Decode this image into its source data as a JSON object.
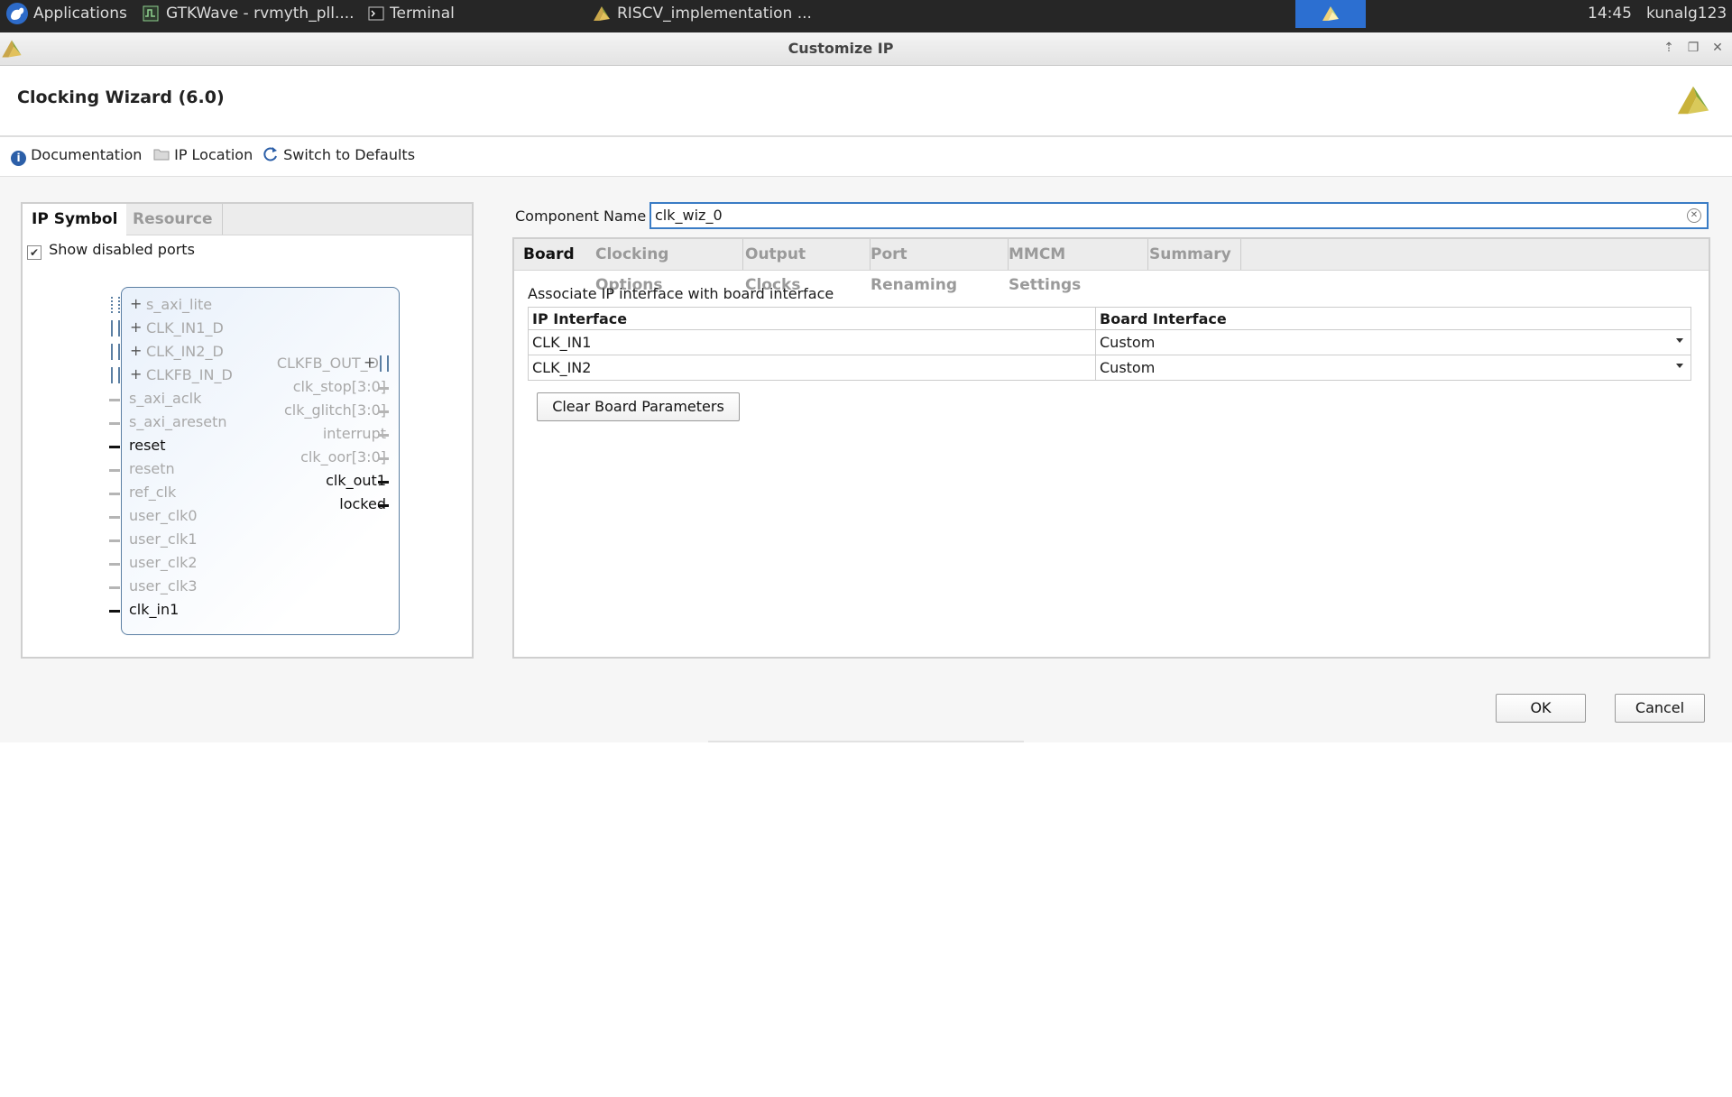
{
  "taskbar": {
    "applications_label": "Applications",
    "items": [
      "GTKWave - rvmyth_pll....",
      "Terminal",
      "RISCV_implementation ..."
    ],
    "clock": "14:45",
    "user": "kunalg123"
  },
  "window": {
    "title": "Customize IP"
  },
  "header": {
    "title": "Clocking Wizard (6.0)"
  },
  "toolbar": {
    "documentation": "Documentation",
    "ip_location": "IP Location",
    "switch_defaults": "Switch to Defaults"
  },
  "left_panel": {
    "tabs": [
      "IP Symbol",
      "Resource"
    ],
    "show_disabled_ports_label": "Show disabled ports",
    "show_disabled_ports_checked": true,
    "left_ports": [
      {
        "label": "s_axi_lite",
        "enabled": false,
        "bus": true
      },
      {
        "label": "CLK_IN1_D",
        "enabled": false,
        "bus": true
      },
      {
        "label": "CLK_IN2_D",
        "enabled": false,
        "bus": true
      },
      {
        "label": "CLKFB_IN_D",
        "enabled": false,
        "bus": true
      },
      {
        "label": "s_axi_aclk",
        "enabled": false,
        "bus": false
      },
      {
        "label": "s_axi_aresetn",
        "enabled": false,
        "bus": false
      },
      {
        "label": "reset",
        "enabled": true,
        "bus": false
      },
      {
        "label": "resetn",
        "enabled": false,
        "bus": false
      },
      {
        "label": "ref_clk",
        "enabled": false,
        "bus": false
      },
      {
        "label": "user_clk0",
        "enabled": false,
        "bus": false
      },
      {
        "label": "user_clk1",
        "enabled": false,
        "bus": false
      },
      {
        "label": "user_clk2",
        "enabled": false,
        "bus": false
      },
      {
        "label": "user_clk3",
        "enabled": false,
        "bus": false
      },
      {
        "label": "clk_in1",
        "enabled": true,
        "bus": false
      }
    ],
    "right_ports": [
      {
        "label": "CLKFB_OUT_D",
        "enabled": false,
        "bus": true
      },
      {
        "label": "clk_stop[3:0]",
        "enabled": false,
        "bus": false
      },
      {
        "label": "clk_glitch[3:0]",
        "enabled": false,
        "bus": false
      },
      {
        "label": "interrupt",
        "enabled": false,
        "bus": false
      },
      {
        "label": "clk_oor[3:0]",
        "enabled": false,
        "bus": false
      },
      {
        "label": "clk_out1",
        "enabled": true,
        "bus": false
      },
      {
        "label": "locked",
        "enabled": true,
        "bus": false
      }
    ]
  },
  "component": {
    "label": "Component Name",
    "value": "clk_wiz_0"
  },
  "config_tabs": [
    "Board",
    "Clocking Options",
    "Output Clocks",
    "Port Renaming",
    "MMCM Settings",
    "Summary"
  ],
  "board": {
    "associate_text": "Associate IP interface with board interface",
    "columns": [
      "IP Interface",
      "Board Interface"
    ],
    "rows": [
      {
        "ip": "CLK_IN1",
        "board": "Custom"
      },
      {
        "ip": "CLK_IN2",
        "board": "Custom"
      }
    ],
    "clear_button": "Clear Board Parameters"
  },
  "buttons": {
    "ok": "OK",
    "cancel": "Cancel"
  },
  "colors": {
    "accent": "#3a7cc5",
    "taskbar": "#262626",
    "active_task": "#2c6fd1"
  }
}
